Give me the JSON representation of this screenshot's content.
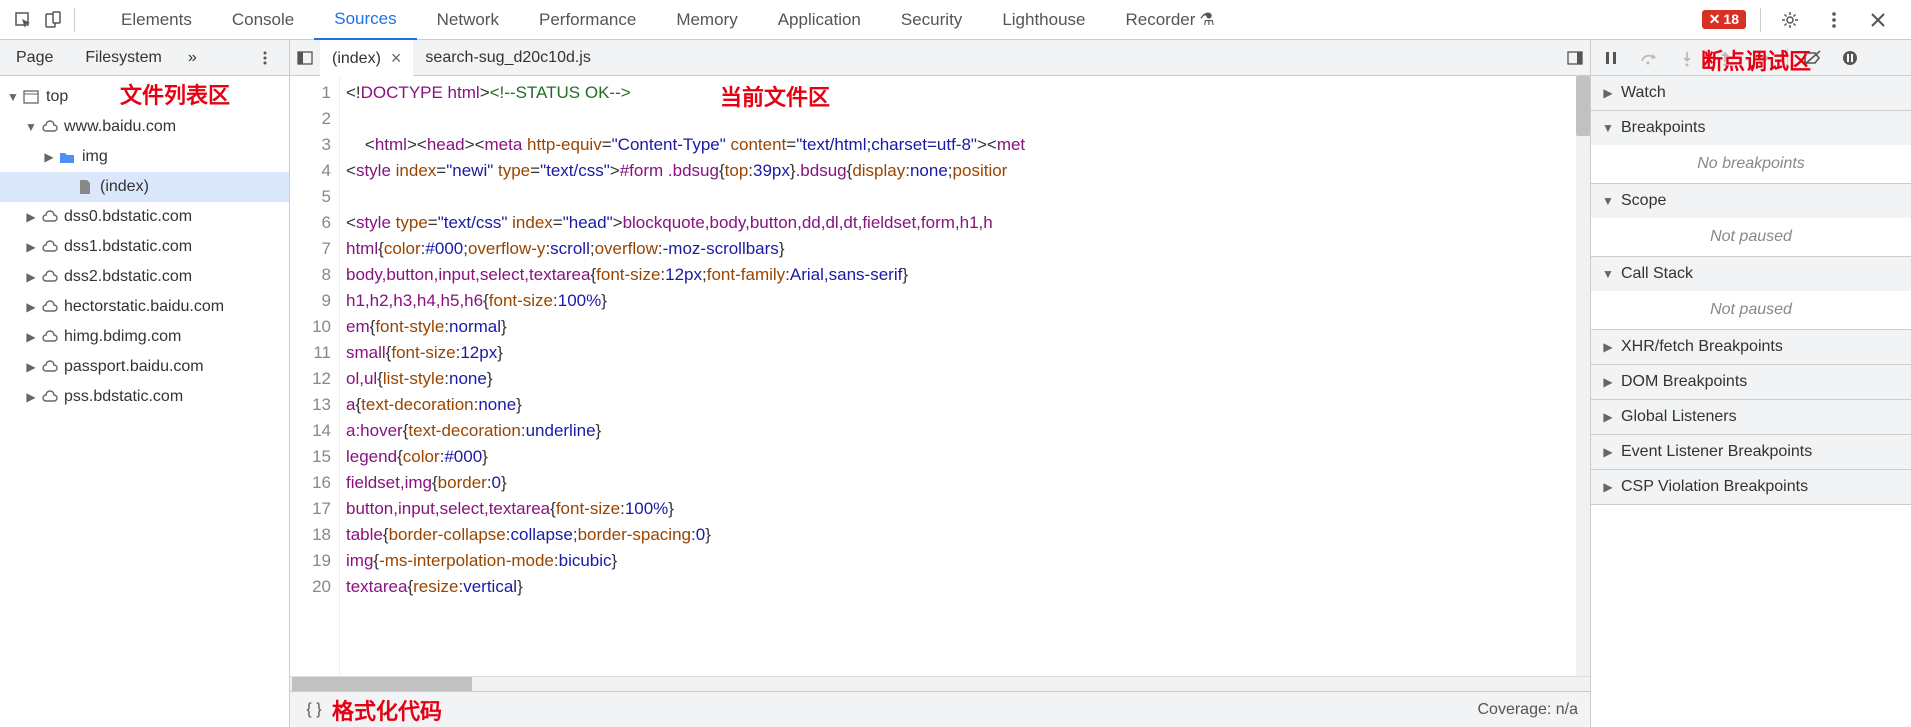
{
  "toolbar": {
    "tabs": [
      "Elements",
      "Console",
      "Sources",
      "Network",
      "Performance",
      "Memory",
      "Application",
      "Security",
      "Lighthouse",
      "Recorder"
    ],
    "active": "Sources",
    "error_count": "18"
  },
  "annotations": {
    "file_list": "文件列表区",
    "current_file": "当前文件区",
    "breakpoint_debug": "断点调试区",
    "format_code": "格式化代码"
  },
  "left": {
    "tabs": [
      "Page",
      "Filesystem"
    ],
    "more": "»",
    "tree": [
      {
        "depth": 0,
        "open": true,
        "icon": "window",
        "label": "top"
      },
      {
        "depth": 1,
        "open": true,
        "icon": "cloud",
        "label": "www.baidu.com"
      },
      {
        "depth": 2,
        "open": false,
        "icon": "folder",
        "label": "img"
      },
      {
        "depth": 3,
        "open": null,
        "icon": "file",
        "label": "(index)",
        "selected": true
      },
      {
        "depth": 1,
        "open": false,
        "icon": "cloud",
        "label": "dss0.bdstatic.com"
      },
      {
        "depth": 1,
        "open": false,
        "icon": "cloud",
        "label": "dss1.bdstatic.com"
      },
      {
        "depth": 1,
        "open": false,
        "icon": "cloud",
        "label": "dss2.bdstatic.com"
      },
      {
        "depth": 1,
        "open": false,
        "icon": "cloud",
        "label": "hectorstatic.baidu.com"
      },
      {
        "depth": 1,
        "open": false,
        "icon": "cloud",
        "label": "himg.bdimg.com"
      },
      {
        "depth": 1,
        "open": false,
        "icon": "cloud",
        "label": "passport.baidu.com"
      },
      {
        "depth": 1,
        "open": false,
        "icon": "cloud",
        "label": "pss.bdstatic.com"
      }
    ]
  },
  "center": {
    "file_tabs": [
      {
        "label": "(index)",
        "active": true,
        "closable": true
      },
      {
        "label": "search-sug_d20c10d.js",
        "active": false,
        "closable": false
      }
    ],
    "code_lines": [
      {
        "n": 1,
        "tokens": [
          [
            "pun",
            "<!"
          ],
          [
            "tag",
            "DOCTYPE html"
          ],
          [
            "pun",
            ">"
          ],
          [
            "com",
            "<!--STATUS OK-->"
          ]
        ]
      },
      {
        "n": 2,
        "tokens": []
      },
      {
        "n": 3,
        "tokens": [
          [
            "pun",
            "    <"
          ],
          [
            "tag",
            "html"
          ],
          [
            "pun",
            "><"
          ],
          [
            "tag",
            "head"
          ],
          [
            "pun",
            "><"
          ],
          [
            "tag",
            "meta"
          ],
          [
            "pun",
            " "
          ],
          [
            "attr",
            "http-equiv"
          ],
          [
            "pun",
            "="
          ],
          [
            "str",
            "\"Content-Type\""
          ],
          [
            "pun",
            " "
          ],
          [
            "attr",
            "content"
          ],
          [
            "pun",
            "="
          ],
          [
            "str",
            "\"text/html;charset=utf-8\""
          ],
          [
            "pun",
            "><"
          ],
          [
            "tag",
            "met"
          ]
        ]
      },
      {
        "n": 4,
        "tokens": [
          [
            "pun",
            "<"
          ],
          [
            "tag",
            "style"
          ],
          [
            "pun",
            " "
          ],
          [
            "attr",
            "index"
          ],
          [
            "pun",
            "="
          ],
          [
            "str",
            "\"newi\""
          ],
          [
            "pun",
            " "
          ],
          [
            "attr",
            "type"
          ],
          [
            "pun",
            "="
          ],
          [
            "str",
            "\"text/css\""
          ],
          [
            "pun",
            ">"
          ],
          [
            "sel",
            "#form .bdsug"
          ],
          [
            "pun",
            "{"
          ],
          [
            "prop",
            "top"
          ],
          [
            "pun",
            ":"
          ],
          [
            "num",
            "39px"
          ],
          [
            "pun",
            "}"
          ],
          [
            "sel",
            ".bdsug"
          ],
          [
            "pun",
            "{"
          ],
          [
            "prop",
            "display"
          ],
          [
            "pun",
            ":"
          ],
          [
            "val",
            "none"
          ],
          [
            "pun",
            ";"
          ],
          [
            "prop",
            "positior"
          ]
        ]
      },
      {
        "n": 5,
        "tokens": []
      },
      {
        "n": 6,
        "tokens": [
          [
            "pun",
            "<"
          ],
          [
            "tag",
            "style"
          ],
          [
            "pun",
            " "
          ],
          [
            "attr",
            "type"
          ],
          [
            "pun",
            "="
          ],
          [
            "str",
            "\"text/css\""
          ],
          [
            "pun",
            " "
          ],
          [
            "attr",
            "index"
          ],
          [
            "pun",
            "="
          ],
          [
            "str",
            "\"head\""
          ],
          [
            "pun",
            ">"
          ],
          [
            "sel",
            "blockquote,body,button,dd,dl,dt,fieldset,form,h1,h"
          ]
        ]
      },
      {
        "n": 7,
        "tokens": [
          [
            "sel",
            "html"
          ],
          [
            "pun",
            "{"
          ],
          [
            "prop",
            "color"
          ],
          [
            "pun",
            ":"
          ],
          [
            "num",
            "#000"
          ],
          [
            "pun",
            ";"
          ],
          [
            "prop",
            "overflow-y"
          ],
          [
            "pun",
            ":"
          ],
          [
            "val",
            "scroll"
          ],
          [
            "pun",
            ";"
          ],
          [
            "prop",
            "overflow"
          ],
          [
            "pun",
            ":"
          ],
          [
            "val",
            "-moz-scrollbars"
          ],
          [
            "pun",
            "}"
          ]
        ]
      },
      {
        "n": 8,
        "tokens": [
          [
            "sel",
            "body,button,input,select,textarea"
          ],
          [
            "pun",
            "{"
          ],
          [
            "prop",
            "font-size"
          ],
          [
            "pun",
            ":"
          ],
          [
            "num",
            "12px"
          ],
          [
            "pun",
            ";"
          ],
          [
            "prop",
            "font-family"
          ],
          [
            "pun",
            ":"
          ],
          [
            "val",
            "Arial,sans-serif"
          ],
          [
            "pun",
            "}"
          ]
        ]
      },
      {
        "n": 9,
        "tokens": [
          [
            "sel",
            "h1,h2,h3,h4,h5,h6"
          ],
          [
            "pun",
            "{"
          ],
          [
            "prop",
            "font-size"
          ],
          [
            "pun",
            ":"
          ],
          [
            "num",
            "100%"
          ],
          [
            "pun",
            "}"
          ]
        ]
      },
      {
        "n": 10,
        "tokens": [
          [
            "sel",
            "em"
          ],
          [
            "pun",
            "{"
          ],
          [
            "prop",
            "font-style"
          ],
          [
            "pun",
            ":"
          ],
          [
            "val",
            "normal"
          ],
          [
            "pun",
            "}"
          ]
        ]
      },
      {
        "n": 11,
        "tokens": [
          [
            "sel",
            "small"
          ],
          [
            "pun",
            "{"
          ],
          [
            "prop",
            "font-size"
          ],
          [
            "pun",
            ":"
          ],
          [
            "num",
            "12px"
          ],
          [
            "pun",
            "}"
          ]
        ]
      },
      {
        "n": 12,
        "tokens": [
          [
            "sel",
            "ol,ul"
          ],
          [
            "pun",
            "{"
          ],
          [
            "prop",
            "list-style"
          ],
          [
            "pun",
            ":"
          ],
          [
            "val",
            "none"
          ],
          [
            "pun",
            "}"
          ]
        ]
      },
      {
        "n": 13,
        "tokens": [
          [
            "sel",
            "a"
          ],
          [
            "pun",
            "{"
          ],
          [
            "prop",
            "text-decoration"
          ],
          [
            "pun",
            ":"
          ],
          [
            "val",
            "none"
          ],
          [
            "pun",
            "}"
          ]
        ]
      },
      {
        "n": 14,
        "tokens": [
          [
            "sel",
            "a:hover"
          ],
          [
            "pun",
            "{"
          ],
          [
            "prop",
            "text-decoration"
          ],
          [
            "pun",
            ":"
          ],
          [
            "val",
            "underline"
          ],
          [
            "pun",
            "}"
          ]
        ]
      },
      {
        "n": 15,
        "tokens": [
          [
            "sel",
            "legend"
          ],
          [
            "pun",
            "{"
          ],
          [
            "prop",
            "color"
          ],
          [
            "pun",
            ":"
          ],
          [
            "num",
            "#000"
          ],
          [
            "pun",
            "}"
          ]
        ]
      },
      {
        "n": 16,
        "tokens": [
          [
            "sel",
            "fieldset,img"
          ],
          [
            "pun",
            "{"
          ],
          [
            "prop",
            "border"
          ],
          [
            "pun",
            ":"
          ],
          [
            "num",
            "0"
          ],
          [
            "pun",
            "}"
          ]
        ]
      },
      {
        "n": 17,
        "tokens": [
          [
            "sel",
            "button,input,select,textarea"
          ],
          [
            "pun",
            "{"
          ],
          [
            "prop",
            "font-size"
          ],
          [
            "pun",
            ":"
          ],
          [
            "num",
            "100%"
          ],
          [
            "pun",
            "}"
          ]
        ]
      },
      {
        "n": 18,
        "tokens": [
          [
            "sel",
            "table"
          ],
          [
            "pun",
            "{"
          ],
          [
            "prop",
            "border-collapse"
          ],
          [
            "pun",
            ":"
          ],
          [
            "val",
            "collapse"
          ],
          [
            "pun",
            ";"
          ],
          [
            "prop",
            "border-spacing"
          ],
          [
            "pun",
            ":"
          ],
          [
            "num",
            "0"
          ],
          [
            "pun",
            "}"
          ]
        ]
      },
      {
        "n": 19,
        "tokens": [
          [
            "sel",
            "img"
          ],
          [
            "pun",
            "{"
          ],
          [
            "prop",
            "-ms-interpolation-mode"
          ],
          [
            "pun",
            ":"
          ],
          [
            "val",
            "bicubic"
          ],
          [
            "pun",
            "}"
          ]
        ]
      },
      {
        "n": 20,
        "tokens": [
          [
            "sel",
            "textarea"
          ],
          [
            "pun",
            "{"
          ],
          [
            "prop",
            "resize"
          ],
          [
            "pun",
            ":"
          ],
          [
            "val",
            "vertical"
          ],
          [
            "pun",
            "}"
          ]
        ]
      }
    ],
    "coverage": "Coverage: n/a"
  },
  "right": {
    "panes": [
      {
        "label": "Watch",
        "open": false,
        "body": null
      },
      {
        "label": "Breakpoints",
        "open": true,
        "body": "No breakpoints"
      },
      {
        "label": "Scope",
        "open": true,
        "body": "Not paused"
      },
      {
        "label": "Call Stack",
        "open": true,
        "body": "Not paused"
      },
      {
        "label": "XHR/fetch Breakpoints",
        "open": false,
        "body": null
      },
      {
        "label": "DOM Breakpoints",
        "open": false,
        "body": null
      },
      {
        "label": "Global Listeners",
        "open": false,
        "body": null
      },
      {
        "label": "Event Listener Breakpoints",
        "open": false,
        "body": null
      },
      {
        "label": "CSP Violation Breakpoints",
        "open": false,
        "body": null
      }
    ]
  }
}
